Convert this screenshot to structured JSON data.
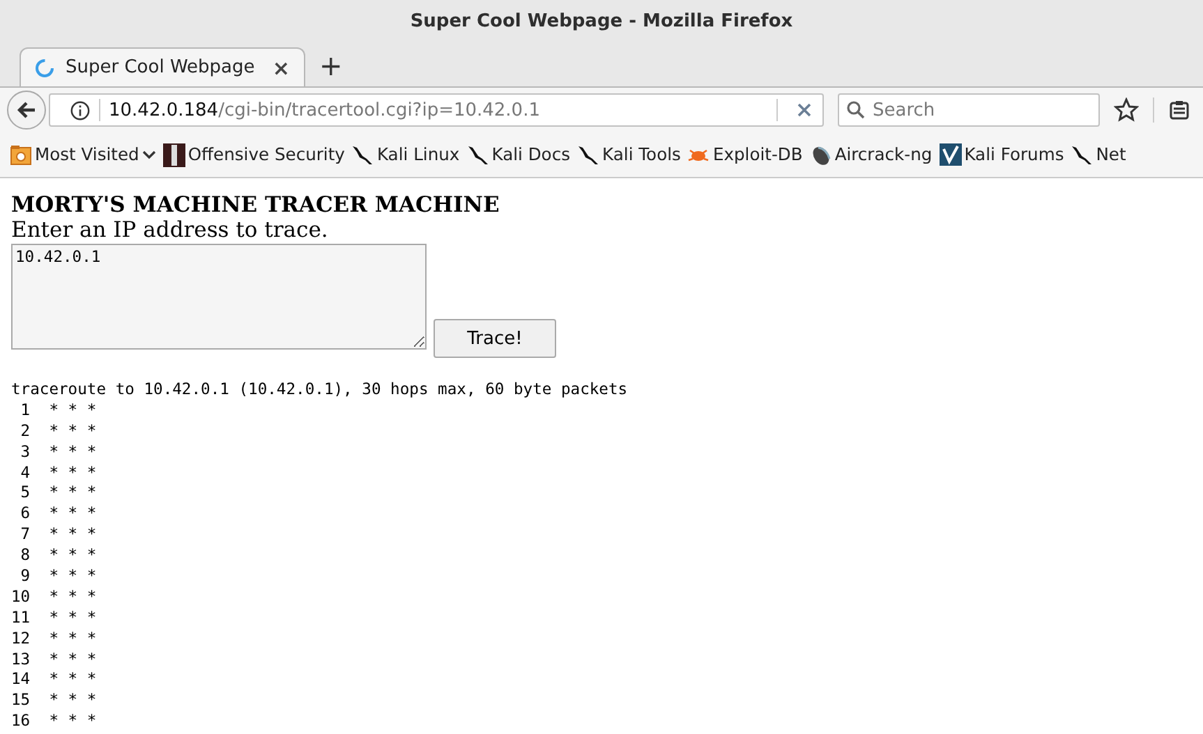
{
  "window": {
    "title": "Super Cool Webpage - Mozilla Firefox"
  },
  "tabs": [
    {
      "label": "Super Cool Webpage",
      "selected": true,
      "close": "×"
    }
  ],
  "new_tab": "+",
  "url": {
    "host": "10.42.0.184",
    "path": "/cgi-bin/tracertool.cgi?ip=10.42.0.1"
  },
  "search": {
    "placeholder": "Search"
  },
  "bookmarks": [
    {
      "label": "Most Visited",
      "kind": "folder"
    },
    {
      "label": "Offensive Security",
      "kind": "offsec"
    },
    {
      "label": "Kali Linux",
      "kind": "kali"
    },
    {
      "label": "Kali Docs",
      "kind": "kali"
    },
    {
      "label": "Kali Tools",
      "kind": "kali"
    },
    {
      "label": "Exploit-DB",
      "kind": "bug"
    },
    {
      "label": "Aircrack-ng",
      "kind": "air"
    },
    {
      "label": "Kali Forums",
      "kind": "forum"
    },
    {
      "label": "Net",
      "kind": "kali"
    }
  ],
  "page": {
    "heading": "MORTY'S MACHINE TRACER MACHINE",
    "prompt": "Enter an IP address to trace.",
    "ip_value": "10.42.0.1",
    "button": "Trace!",
    "output": [
      "traceroute to 10.42.0.1 (10.42.0.1), 30 hops max, 60 byte packets",
      " 1  * * *",
      " 2  * * *",
      " 3  * * *",
      " 4  * * *",
      " 5  * * *",
      " 6  * * *",
      " 7  * * *",
      " 8  * * *",
      " 9  * * *",
      "10  * * *",
      "11  * * *",
      "12  * * *",
      "13  * * *",
      "14  * * *",
      "15  * * *",
      "16  * * *"
    ]
  }
}
